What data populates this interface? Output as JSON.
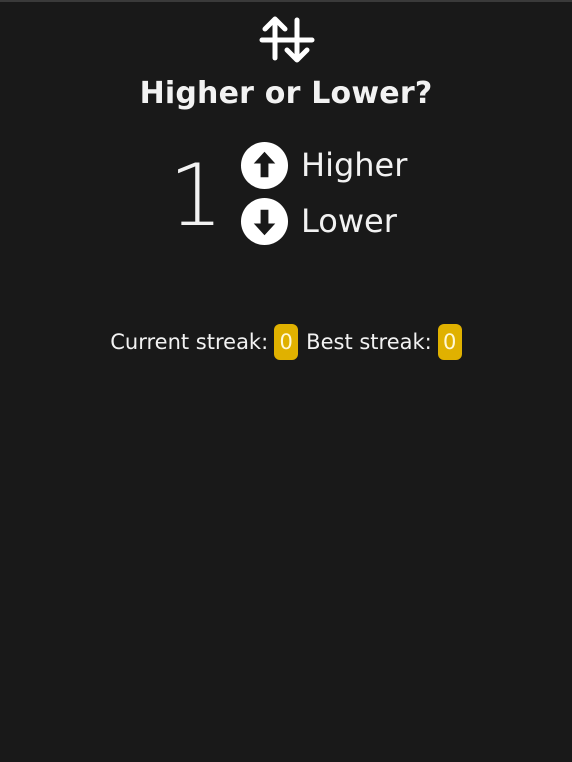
{
  "app": {
    "title": "Higher or Lower?",
    "logo_icon": "up-down-arrows-icon"
  },
  "game": {
    "current_number": "1"
  },
  "choices": {
    "higher": {
      "label": "Higher",
      "icon": "arrow-up-circle-icon"
    },
    "lower": {
      "label": "Lower",
      "icon": "arrow-down-circle-icon"
    }
  },
  "stats": {
    "current_label": "Current streak:",
    "current_value": "0",
    "best_label": "Best streak:",
    "best_value": "0"
  },
  "colors": {
    "background": "#191919",
    "text": "#f2f2f2",
    "badge": "#e0b100"
  }
}
